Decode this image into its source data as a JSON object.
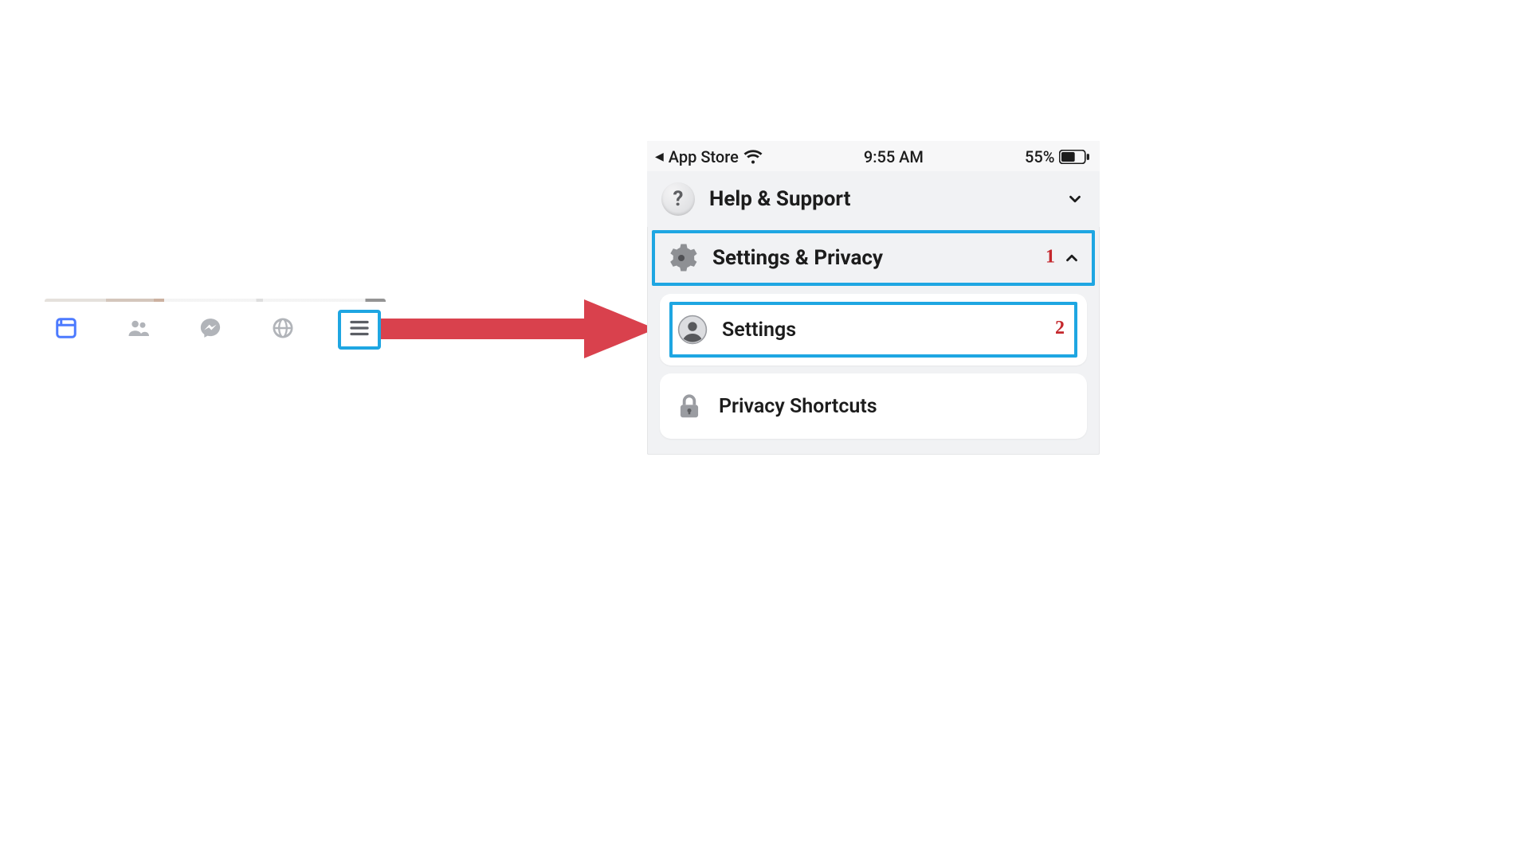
{
  "nav": {
    "items": [
      "feed",
      "friends",
      "messenger",
      "notifications",
      "menu"
    ],
    "highlighted": "menu"
  },
  "status_bar": {
    "back_app": "App Store",
    "time": "9:55 AM",
    "battery_pct": "55%"
  },
  "menu": {
    "help_support": {
      "label": "Help & Support",
      "expanded": false
    },
    "settings_privacy": {
      "label": "Settings & Privacy",
      "expanded": true,
      "annotation": "1",
      "items": [
        {
          "id": "settings",
          "label": "Settings",
          "annotation": "2"
        },
        {
          "id": "privacy_shortcuts",
          "label": "Privacy Shortcuts"
        }
      ]
    }
  },
  "colors": {
    "highlight": "#1ea6e2",
    "annotation": "#c4272c",
    "arrow": "#d9414d",
    "nav_active": "#4c7aff",
    "nav_inactive": "#b1b4b9"
  }
}
